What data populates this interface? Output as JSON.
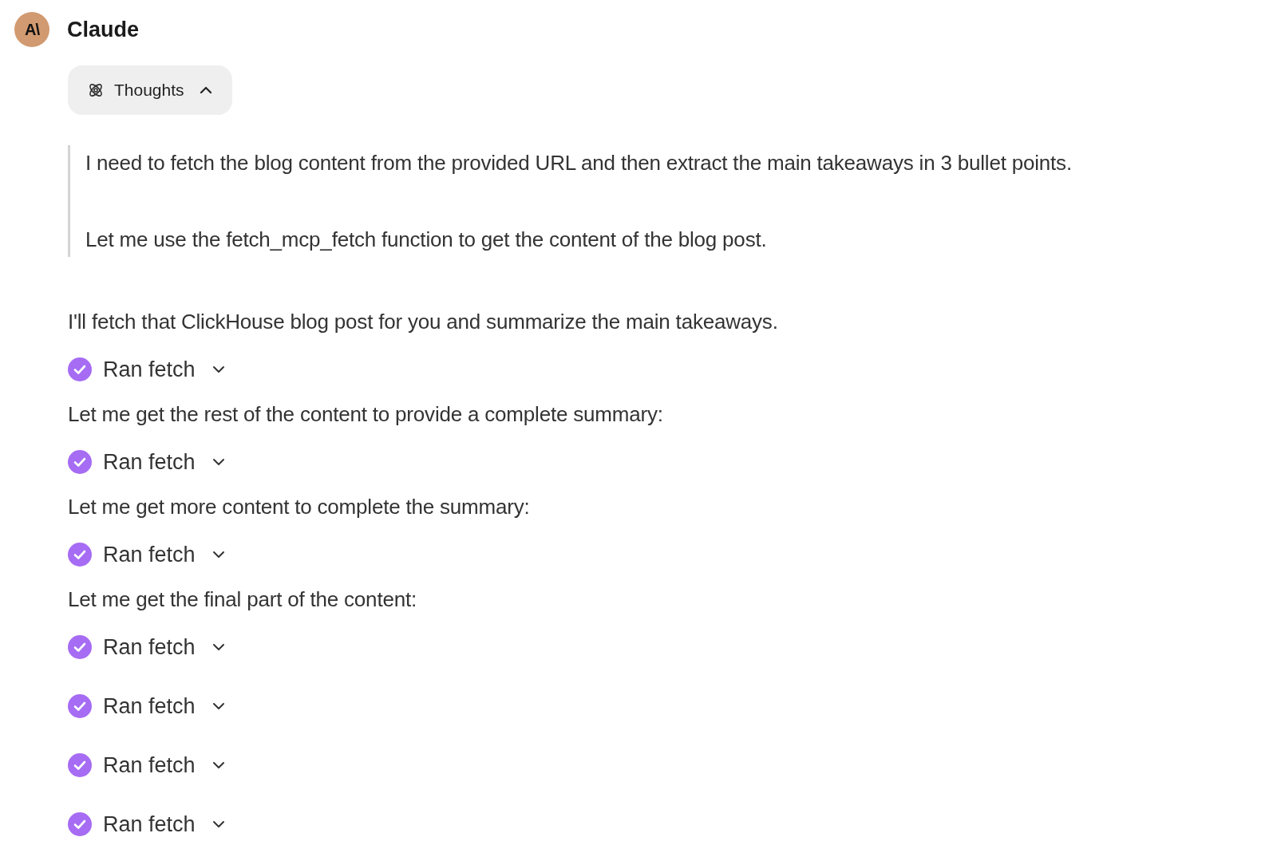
{
  "header": {
    "avatar": "A\\",
    "name": "Claude"
  },
  "thoughts": {
    "label": "Thoughts",
    "expanded": true,
    "paragraphs": [
      "I need to fetch the blog content from the provided URL and then extract the main takeaways in 3 bullet points.",
      "Let me use the fetch_mcp_fetch function to get the content of the blog post."
    ]
  },
  "blocks": [
    {
      "kind": "text",
      "text": "I'll fetch that ClickHouse blog post for you and summarize the main takeaways."
    },
    {
      "kind": "tool",
      "label": "Ran fetch",
      "expanded": false
    },
    {
      "kind": "text",
      "text": "Let me get the rest of the content to provide a complete summary:"
    },
    {
      "kind": "tool",
      "label": "Ran fetch",
      "expanded": false
    },
    {
      "kind": "text",
      "text": "Let me get more content to complete the summary:"
    },
    {
      "kind": "tool",
      "label": "Ran fetch",
      "expanded": false
    },
    {
      "kind": "text",
      "text": "Let me get the final part of the content:"
    },
    {
      "kind": "tool",
      "label": "Ran fetch",
      "expanded": false
    },
    {
      "kind": "tool",
      "label": "Ran fetch",
      "expanded": false
    },
    {
      "kind": "tool",
      "label": "Ran fetch",
      "expanded": false
    },
    {
      "kind": "tool",
      "label": "Ran fetch",
      "expanded": false
    }
  ]
}
